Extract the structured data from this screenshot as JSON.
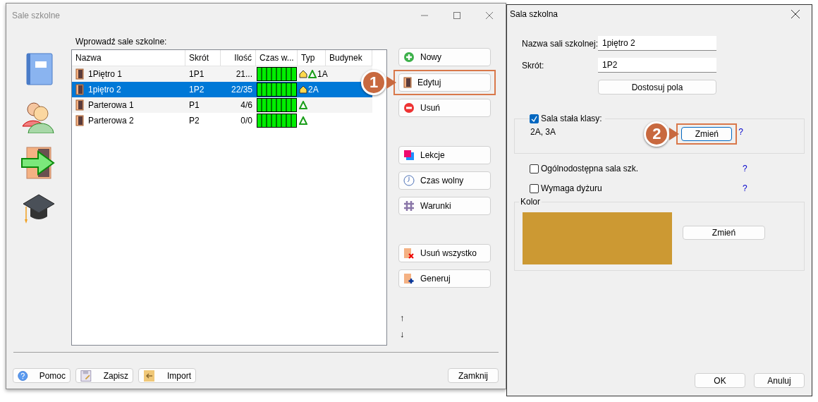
{
  "main_window": {
    "title": "Sale szkolne",
    "list_label": "Wprowadź sale szkolne:",
    "table": {
      "columns": [
        "Nazwa",
        "Skrót",
        "Ilość",
        "Czas w...",
        "Typ",
        "Budynek"
      ],
      "rows": [
        {
          "name": "1Piętro 1",
          "short": "1P1",
          "count": "21...",
          "home": true,
          "shared": true,
          "class": "1A",
          "selected": false
        },
        {
          "name": "1piętro 2",
          "short": "1P2",
          "count": "22/35",
          "home": true,
          "shared": false,
          "class": "2A",
          "selected": true
        },
        {
          "name": "Parterowa 1",
          "short": "P1",
          "count": "4/6",
          "home": false,
          "shared": true,
          "selected": false
        },
        {
          "name": "Parterowa 2",
          "short": "P2",
          "count": "0/0",
          "home": false,
          "shared": true,
          "selected": false
        }
      ]
    },
    "button_groups": [
      [
        {
          "label": "Nowy",
          "kind": "add"
        },
        {
          "label": "Edytuj",
          "kind": "edit",
          "callout": "1"
        },
        {
          "label": "Usuń",
          "kind": "remove"
        }
      ],
      [
        {
          "label": "Lekcje",
          "kind": "lessons"
        },
        {
          "label": "Czas wolny",
          "kind": "time"
        },
        {
          "label": "Warunki",
          "kind": "conditions"
        }
      ],
      [
        {
          "label": "Usuń wszystko",
          "kind": "clear"
        },
        {
          "label": "Generuj",
          "kind": "generate"
        }
      ]
    ],
    "order_arrows": [
      "↑",
      "↓"
    ],
    "footer_buttons": [
      {
        "label": "Pomoc",
        "kind": "help"
      },
      {
        "label": "Zapisz",
        "kind": "save"
      },
      {
        "label": "Import",
        "kind": "import"
      }
    ],
    "close_button": "Zamknij"
  },
  "dialog": {
    "title": "Sala szkolna",
    "fields": [
      {
        "label": "Nazwa sali szkolnej:",
        "value": "1piętro 2"
      },
      {
        "label": "Skrót:",
        "value": "1P2"
      }
    ],
    "adjust_button": "Dostosuj pola",
    "fixed_class": {
      "label": "Sala stała klasy:",
      "checked": true,
      "value": "2A, 3A",
      "button": "Zmień",
      "callout": "2",
      "help": "?"
    },
    "options": [
      {
        "label": "Ogólnodostępna sala szk.",
        "checked": false,
        "help": "?"
      },
      {
        "label": "Wymaga dyżuru",
        "checked": false,
        "help": "?"
      }
    ],
    "color_group": {
      "legend": "Kolor",
      "color": "#cc9933",
      "button": "Zmień"
    },
    "buttons": [
      "OK",
      "Anuluj"
    ]
  }
}
